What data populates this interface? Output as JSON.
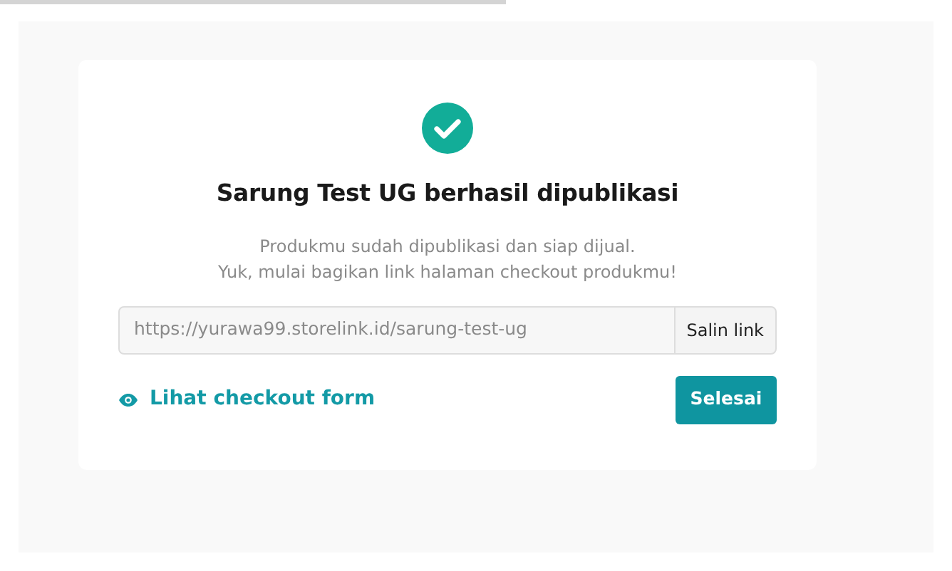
{
  "dialog": {
    "title": "Sarung Test UG berhasil dipublikasi",
    "message_lines": [
      "Produkmu sudah dipublikasi dan siap dijual.",
      "Yuk, mulai bagikan link halaman checkout produkmu!"
    ],
    "link_field": {
      "value": "https://yurawa99.storelink.id/sarung-test-ug"
    },
    "copy_button": "Salin link",
    "view_link": "Lihat checkout form",
    "done_button": "Selesai"
  }
}
